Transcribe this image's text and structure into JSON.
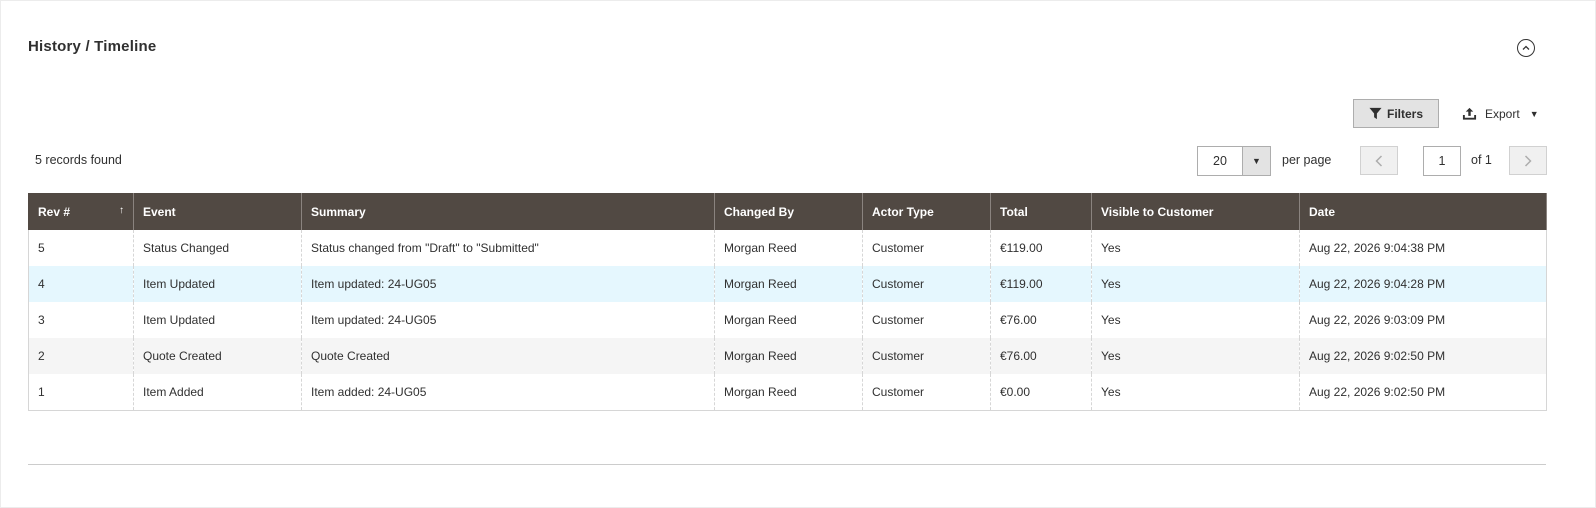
{
  "section": {
    "title": "History / Timeline"
  },
  "toolbar": {
    "filters_label": "Filters",
    "export_label": "Export"
  },
  "records_found": "5 records found",
  "pagination": {
    "per_page_value": "20",
    "per_page_label": "per page",
    "current_page": "1",
    "of_label": "of 1"
  },
  "table": {
    "columns": [
      "Rev #",
      "Event",
      "Summary",
      "Changed By",
      "Actor Type",
      "Total",
      "Visible to Customer",
      "Date"
    ],
    "sort_indicator": "↑",
    "rows": [
      [
        "5",
        "Status Changed",
        "Status changed from \"Draft\" to \"Submitted\"",
        "Morgan Reed",
        "Customer",
        "€119.00",
        "Yes",
        "Aug 22, 2026 9:04:38 PM"
      ],
      [
        "4",
        "Item Updated",
        "Item updated: 24-UG05",
        "Morgan Reed",
        "Customer",
        "€119.00",
        "Yes",
        "Aug 22, 2026 9:04:28 PM"
      ],
      [
        "3",
        "Item Updated",
        "Item updated: 24-UG05",
        "Morgan Reed",
        "Customer",
        "€76.00",
        "Yes",
        "Aug 22, 2026 9:03:09 PM"
      ],
      [
        "2",
        "Quote Created",
        "Quote Created",
        "Morgan Reed",
        "Customer",
        "€76.00",
        "Yes",
        "Aug 22, 2026 9:02:50 PM"
      ],
      [
        "1",
        "Item Added",
        "Item added: 24-UG05",
        "Morgan Reed",
        "Customer",
        "€0.00",
        "Yes",
        "Aug 22, 2026 9:02:50 PM"
      ]
    ]
  },
  "icons": {
    "collapse": "chevron-up-circle-icon",
    "filter": "funnel-icon",
    "export": "upload-icon",
    "prev": "chevron-left-icon",
    "next": "chevron-right-icon"
  },
  "colors": {
    "header_bg": "#514943",
    "highlight_row": "#e5f7fe",
    "alt_row": "#f5f5f5"
  }
}
